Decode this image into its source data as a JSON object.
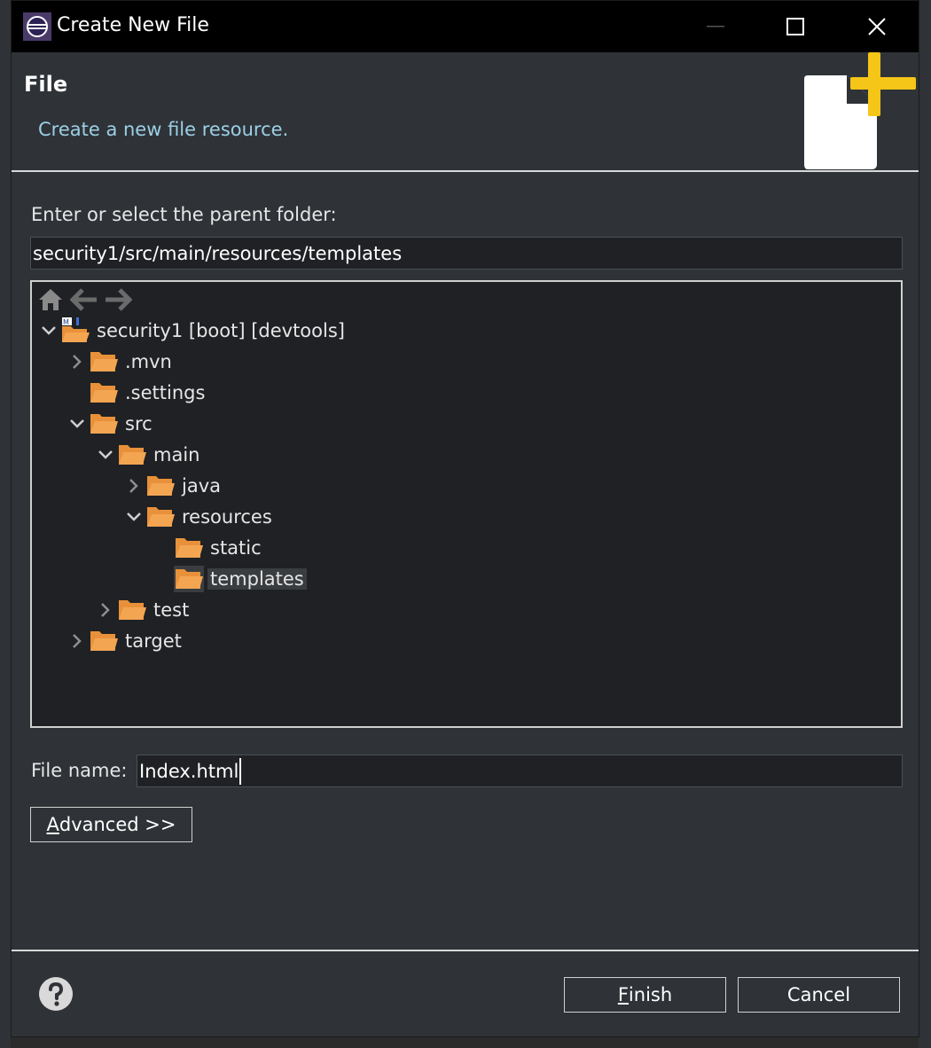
{
  "window": {
    "title": "Create New File"
  },
  "header": {
    "title": "File",
    "description": "Create a new file resource."
  },
  "parent_folder": {
    "label": "Enter or select the parent folder:",
    "value": "security1/src/main/resources/templates"
  },
  "tree": {
    "toolbar": [
      "home-icon",
      "back-arrow-icon",
      "forward-arrow-icon"
    ],
    "nodes": [
      {
        "label": "security1 [boot] [devtools]",
        "depth": 0,
        "expanded": true,
        "has_children": true,
        "selected": false
      },
      {
        "label": ".mvn",
        "depth": 1,
        "expanded": false,
        "has_children": true,
        "selected": false
      },
      {
        "label": ".settings",
        "depth": 1,
        "expanded": false,
        "has_children": false,
        "selected": false
      },
      {
        "label": "src",
        "depth": 1,
        "expanded": true,
        "has_children": true,
        "selected": false
      },
      {
        "label": "main",
        "depth": 2,
        "expanded": true,
        "has_children": true,
        "selected": false
      },
      {
        "label": "java",
        "depth": 3,
        "expanded": false,
        "has_children": true,
        "selected": false
      },
      {
        "label": "resources",
        "depth": 3,
        "expanded": true,
        "has_children": true,
        "selected": false
      },
      {
        "label": "static",
        "depth": 4,
        "expanded": false,
        "has_children": false,
        "selected": false
      },
      {
        "label": "templates",
        "depth": 4,
        "expanded": false,
        "has_children": false,
        "selected": true
      },
      {
        "label": "test",
        "depth": 2,
        "expanded": false,
        "has_children": true,
        "selected": false
      },
      {
        "label": "target",
        "depth": 1,
        "expanded": false,
        "has_children": true,
        "selected": false
      }
    ]
  },
  "file_name": {
    "label": "File name:",
    "value": "Index.html"
  },
  "buttons": {
    "advanced_mnemonic": "A",
    "advanced_rest": "dvanced >>",
    "finish_mnemonic": "F",
    "finish_rest": "inish",
    "cancel": "Cancel"
  },
  "colors": {
    "folder": "#e8913a",
    "accent_desc": "#9ccfe6",
    "plus_badge": "#f5c518"
  }
}
